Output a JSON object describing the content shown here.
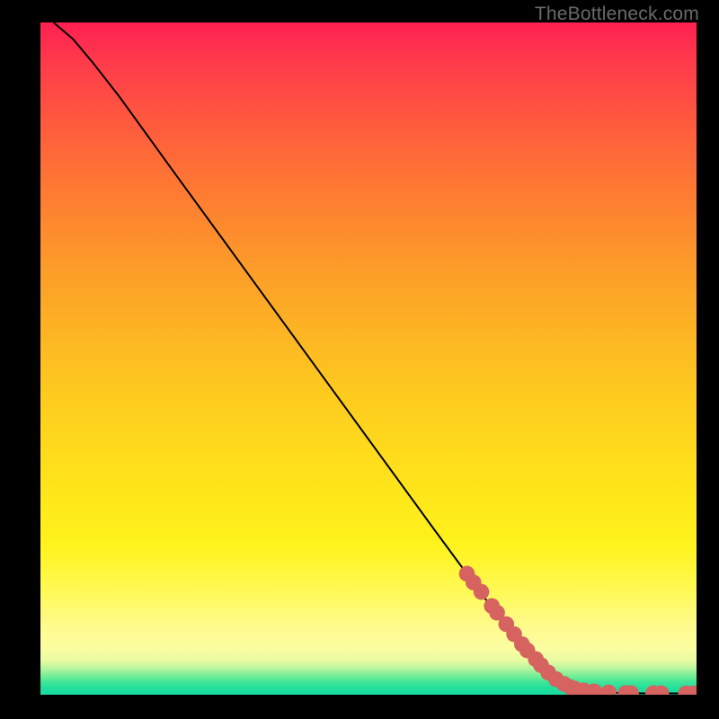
{
  "watermark": "TheBottleneck.com",
  "chart_data": {
    "type": "line",
    "title": "",
    "xlabel": "",
    "ylabel": "",
    "xlim": [
      0,
      100
    ],
    "ylim": [
      0,
      100
    ],
    "grid": false,
    "legend": false,
    "series": [
      {
        "name": "curve",
        "x": [
          2,
          5,
          8,
          12,
          20,
          30,
          40,
          50,
          60,
          68,
          75,
          80,
          84,
          87,
          89.5,
          91,
          93,
          95,
          97,
          99,
          100
        ],
        "y": [
          100,
          97.5,
          94,
          89,
          78.2,
          64.8,
          51.4,
          38.0,
          24.6,
          14.0,
          5.2,
          1.6,
          0.55,
          0.3,
          0.25,
          0.22,
          0.2,
          0.2,
          0.2,
          0.2,
          0.2
        ]
      }
    ],
    "marker_points": {
      "name": "dots",
      "comment": "salmon markers clustered on lower-right segment of curve",
      "x": [
        65.0,
        66.0,
        67.2,
        68.8,
        69.6,
        71.0,
        72.2,
        73.4,
        74.2,
        75.5,
        76.3,
        77.4,
        78.6,
        79.8,
        80.8,
        81.4,
        82.8,
        84.4,
        86.6,
        89.2,
        90.0,
        93.4,
        94.6,
        98.4,
        99.6
      ],
      "y": [
        18.0,
        16.7,
        15.3,
        13.2,
        12.2,
        10.5,
        9.0,
        7.5,
        6.6,
        5.3,
        4.4,
        3.3,
        2.3,
        1.6,
        1.1,
        0.9,
        0.65,
        0.5,
        0.35,
        0.25,
        0.24,
        0.22,
        0.22,
        0.2,
        0.2
      ]
    }
  }
}
